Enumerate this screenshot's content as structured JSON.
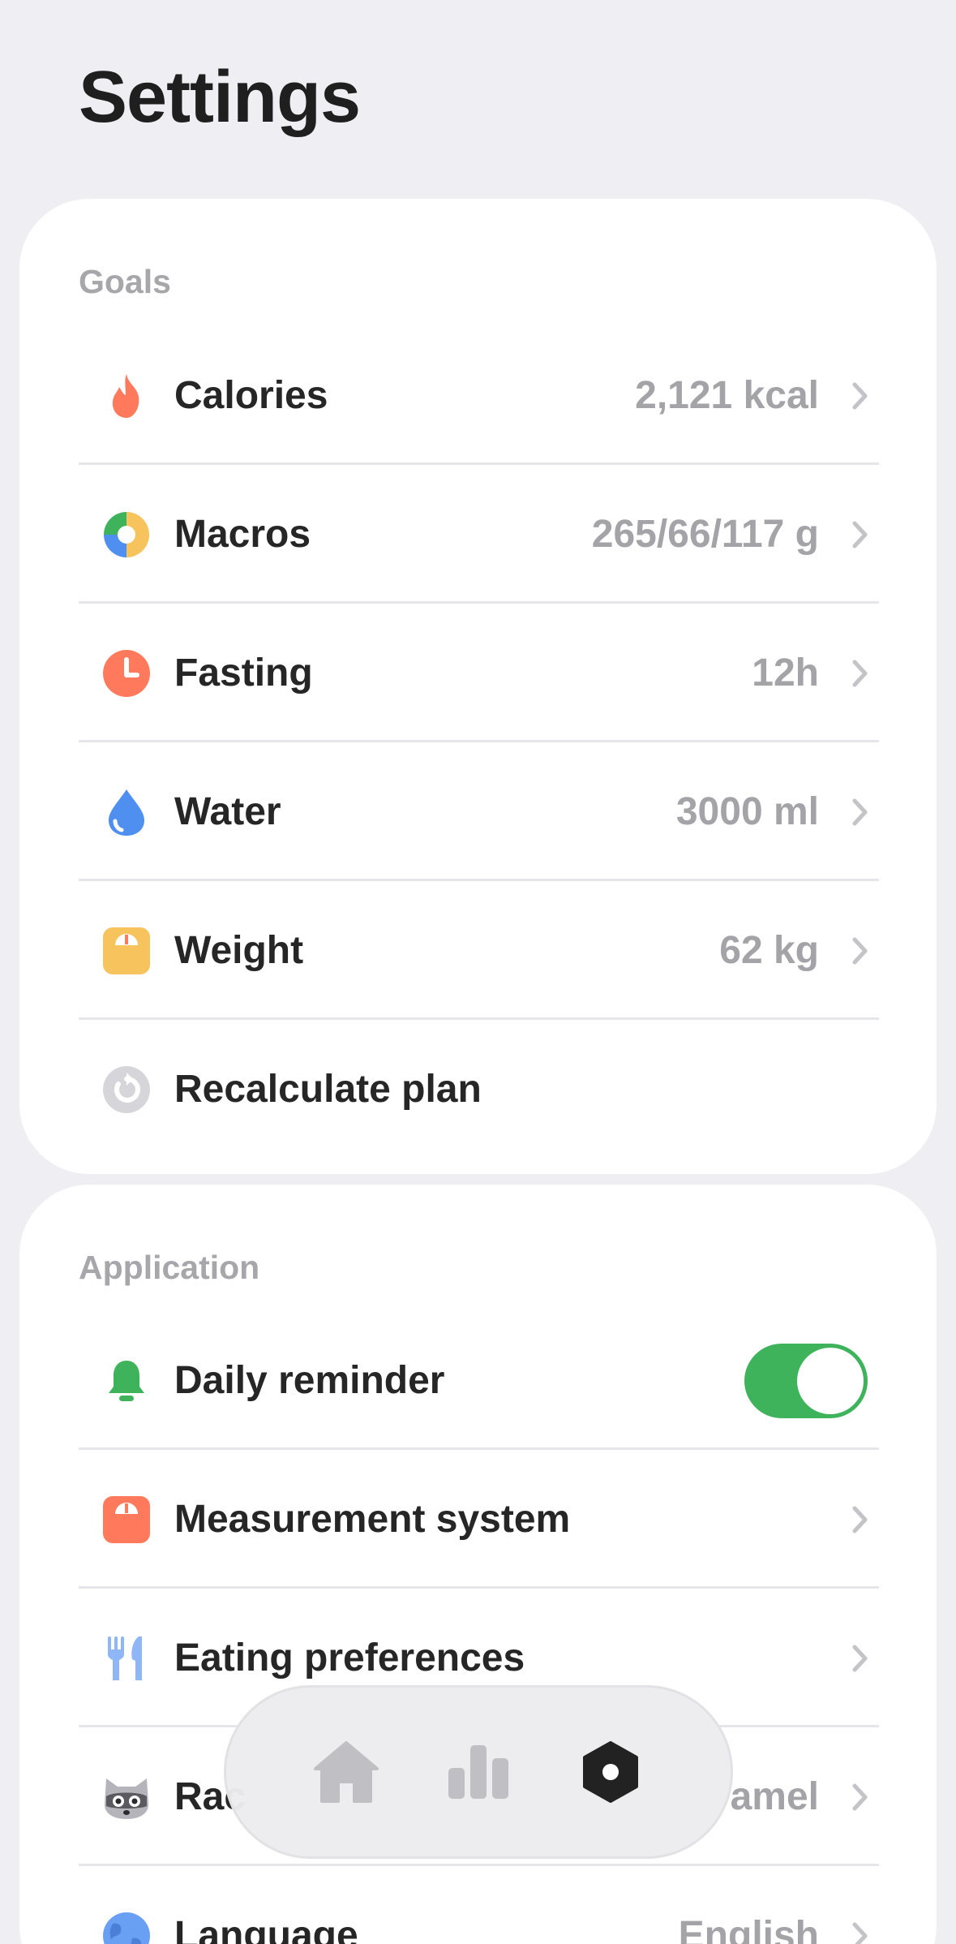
{
  "page": {
    "title": "Settings"
  },
  "goals": {
    "section_label": "Goals",
    "items": [
      {
        "label": "Calories",
        "value": "2,121 kcal",
        "icon": "flame-icon"
      },
      {
        "label": "Macros",
        "value": "265/66/117 g",
        "icon": "pie-chart-icon"
      },
      {
        "label": "Fasting",
        "value": "12h",
        "icon": "clock-icon"
      },
      {
        "label": "Water",
        "value": "3000 ml",
        "icon": "water-drop-icon"
      },
      {
        "label": "Weight",
        "value": "62 kg",
        "icon": "scale-icon"
      },
      {
        "label": "Recalculate plan",
        "icon": "refresh-icon"
      }
    ]
  },
  "application": {
    "section_label": "Application",
    "items": [
      {
        "label": "Daily reminder",
        "toggle_on": true,
        "icon": "bell-icon"
      },
      {
        "label": "Measurement system",
        "icon": "scale-icon"
      },
      {
        "label": "Eating preferences",
        "icon": "fork-knife-icon"
      },
      {
        "label": "Rac",
        "value": "amel",
        "icon": "raccoon-icon"
      },
      {
        "label": "Language",
        "value": "English",
        "icon": "globe-icon"
      }
    ]
  },
  "tabbar": {
    "tabs": [
      {
        "name": "home",
        "icon": "home-icon",
        "active": false
      },
      {
        "name": "stats",
        "icon": "bar-chart-icon",
        "active": false
      },
      {
        "name": "settings",
        "icon": "settings-icon",
        "active": true
      }
    ]
  },
  "colors": {
    "background": "#efeff3",
    "card": "#ffffff",
    "toggle_on": "#3fb35b",
    "secondary_text": "#a3a3a8",
    "flame": "#ff7a5c",
    "water": "#4f8ff0",
    "weight": "#f7c35c",
    "bell": "#3fb35b"
  }
}
